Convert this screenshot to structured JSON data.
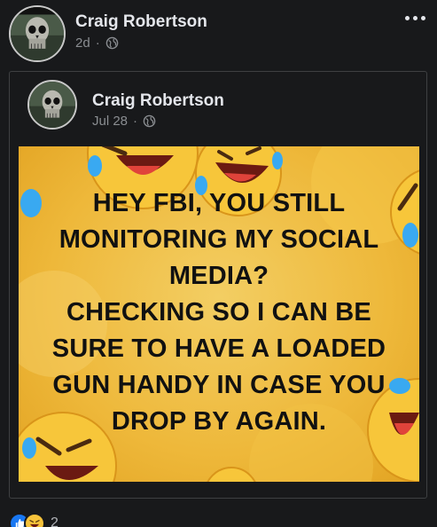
{
  "post": {
    "author": "Craig Robertson",
    "time": "2d",
    "separator": "·",
    "privacy_icon": "globe-icon",
    "more_icon": "more-options-icon"
  },
  "shared_post": {
    "author": "Craig Robertson",
    "time": "Jul 28",
    "separator": "·",
    "privacy_icon": "globe-icon"
  },
  "meme": {
    "lines": [
      "HEY FBI, YOU STILL",
      "MONITORING MY SOCIAL",
      "MEDIA?",
      "CHECKING SO I CAN BE",
      "SURE TO HAVE A LOADED",
      "GUN HANDY IN CASE YOU",
      "DROP BY AGAIN."
    ],
    "background_color": "#eeb83a",
    "decor_icon": "laughing-emoji-icon"
  },
  "reactions": {
    "icons": [
      "like-icon",
      "haha-icon"
    ],
    "count": "2"
  }
}
